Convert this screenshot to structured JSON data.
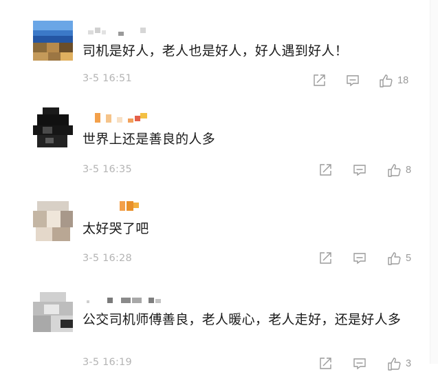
{
  "comments": [
    {
      "text": "司机是好人，老人也是好人，好人遇到好人！",
      "time": "3-5 16:51",
      "likes": "18"
    },
    {
      "text": "世界上还是善良的人多",
      "time": "3-5 16:35",
      "likes": "8"
    },
    {
      "text": "太好哭了吧",
      "time": "3-5 16:28",
      "likes": "5"
    },
    {
      "text": "公交司机师傅善良，老人暖心，老人走好，还是好人多",
      "time": "3-5 16:19",
      "likes": "3"
    }
  ],
  "colors": {
    "text": "#1a1a1a",
    "meta": "#b4b4b4",
    "icon": "#9a9a9a"
  },
  "icons": [
    "share-icon",
    "comment-icon",
    "like-icon"
  ]
}
